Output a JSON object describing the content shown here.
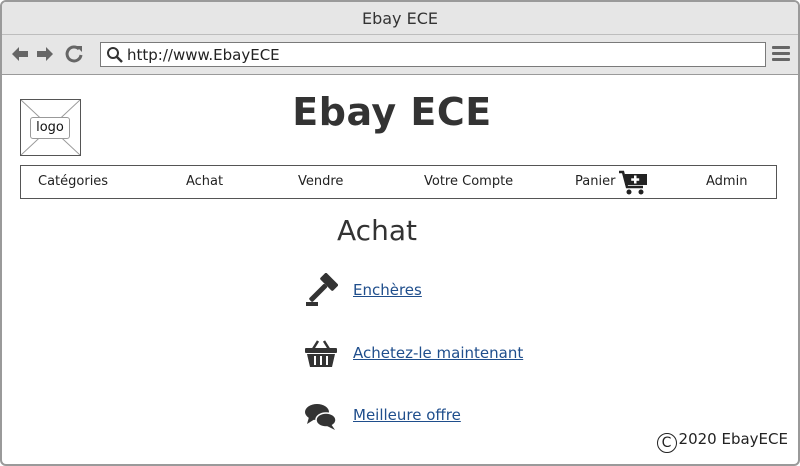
{
  "window": {
    "title": "Ebay ECE"
  },
  "browser": {
    "url": "http://www.EbayECE"
  },
  "header": {
    "logo_text": "logo",
    "site_title": "Ebay ECE"
  },
  "nav": {
    "items": [
      "Catégories",
      "Achat",
      "Vendre",
      "Votre Compte",
      "Panier",
      "Admin"
    ]
  },
  "main": {
    "heading": "Achat",
    "options": [
      {
        "label": "Enchères",
        "icon": "gavel-icon"
      },
      {
        "label": "Achetez-le maintenant",
        "icon": "basket-icon"
      },
      {
        "label": "Meilleure offre",
        "icon": "chat-bubbles-icon"
      }
    ]
  },
  "footer": {
    "copyright_symbol": "C",
    "text": "2020 EbayECE"
  },
  "colors": {
    "link": "#1f4e8c",
    "chrome": "#e6e6e6",
    "icon": "#333333"
  }
}
